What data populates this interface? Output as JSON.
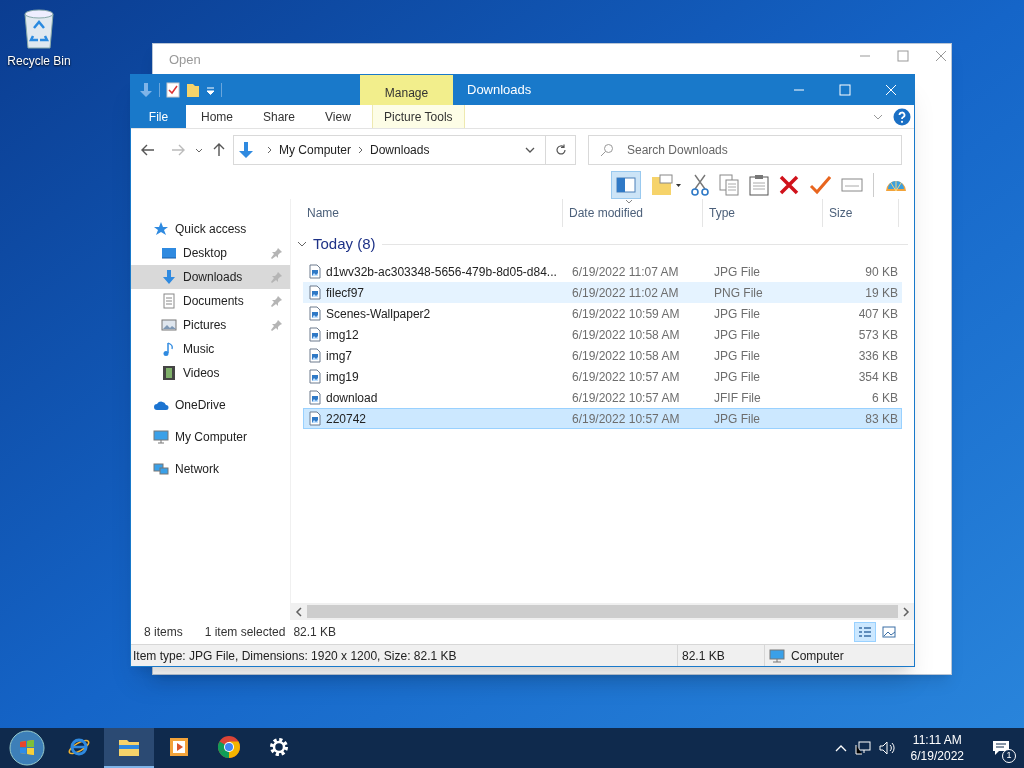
{
  "desktop_icons": [
    {
      "label": "Recycle Bin"
    }
  ],
  "background_window": {
    "title": "Open"
  },
  "window": {
    "title": "Downloads",
    "contextual_tab": "Manage"
  },
  "ribbon_tabs": [
    {
      "label": "File",
      "kind": "file"
    },
    {
      "label": "Home",
      "kind": "tab"
    },
    {
      "label": "Share",
      "kind": "tab"
    },
    {
      "label": "View",
      "kind": "tab"
    },
    {
      "label": "Picture Tools",
      "kind": "contextual"
    }
  ],
  "address": {
    "path": [
      "My Computer",
      "Downloads"
    ]
  },
  "search": {
    "placeholder": "Search Downloads"
  },
  "nav": [
    {
      "label": "Quick access",
      "kind": "star",
      "selected": false,
      "children": [
        {
          "label": "Desktop",
          "kind": "desktop",
          "pinned": true,
          "selected": false
        },
        {
          "label": "Downloads",
          "kind": "download",
          "pinned": true,
          "selected": true
        },
        {
          "label": "Documents",
          "kind": "document",
          "pinned": true,
          "selected": false
        },
        {
          "label": "Pictures",
          "kind": "picture",
          "pinned": true,
          "selected": false
        },
        {
          "label": "Music",
          "kind": "music",
          "pinned": false,
          "selected": false
        },
        {
          "label": "Videos",
          "kind": "video",
          "pinned": false,
          "selected": false
        }
      ]
    },
    {
      "label": "OneDrive",
      "kind": "cloud",
      "selected": false
    },
    {
      "label": "My Computer",
      "kind": "computer",
      "selected": false
    },
    {
      "label": "Network",
      "kind": "network",
      "selected": false
    }
  ],
  "columns": [
    {
      "label": "Name",
      "sorted": false
    },
    {
      "label": "Date modified",
      "sorted": true
    },
    {
      "label": "Type",
      "sorted": false
    },
    {
      "label": "Size",
      "sorted": false
    }
  ],
  "group": {
    "label": "Today (8)",
    "expanded": true
  },
  "files": [
    {
      "name": "d1wv32b-ac303348-5656-479b-8d05-d84...",
      "date": "6/19/2022 11:07 AM",
      "type": "JPG File",
      "size": "90 KB",
      "selected": false,
      "hot": false
    },
    {
      "name": "filecf97",
      "date": "6/19/2022 11:02 AM",
      "type": "PNG File",
      "size": "19 KB",
      "selected": false,
      "hot": true
    },
    {
      "name": "Scenes-Wallpaper2",
      "date": "6/19/2022 10:59 AM",
      "type": "JPG File",
      "size": "407 KB",
      "selected": false,
      "hot": false
    },
    {
      "name": "img12",
      "date": "6/19/2022 10:58 AM",
      "type": "JPG File",
      "size": "573 KB",
      "selected": false,
      "hot": false
    },
    {
      "name": "img7",
      "date": "6/19/2022 10:58 AM",
      "type": "JPG File",
      "size": "336 KB",
      "selected": false,
      "hot": false
    },
    {
      "name": "img19",
      "date": "6/19/2022 10:57 AM",
      "type": "JPG File",
      "size": "354 KB",
      "selected": false,
      "hot": false
    },
    {
      "name": "download",
      "date": "6/19/2022 10:57 AM",
      "type": "JFIF File",
      "size": "6 KB",
      "selected": false,
      "hot": false
    },
    {
      "name": "220742",
      "date": "6/19/2022 10:57 AM",
      "type": "JPG File",
      "size": "83 KB",
      "selected": true,
      "hot": false
    }
  ],
  "status": {
    "count": "8 items",
    "selection": "1 item selected",
    "selection_size": "82.1 KB",
    "view_buttons": [
      {
        "kind": "details",
        "selected": true
      },
      {
        "kind": "thumbnails",
        "selected": false
      }
    ]
  },
  "status_bar": {
    "info": "Item type: JPG File, Dimensions: 1920 x 1200, Size: 82.1 KB",
    "size": "82.1 KB",
    "zone": "Computer"
  },
  "taskbar": {
    "apps": [
      {
        "kind": "ie",
        "active": false
      },
      {
        "kind": "explorer",
        "active": true
      },
      {
        "kind": "media",
        "active": false
      },
      {
        "kind": "chrome",
        "active": false
      },
      {
        "kind": "settings",
        "active": false
      }
    ],
    "time": "11:11 AM",
    "date": "6/19/2022",
    "notifications": "1"
  }
}
